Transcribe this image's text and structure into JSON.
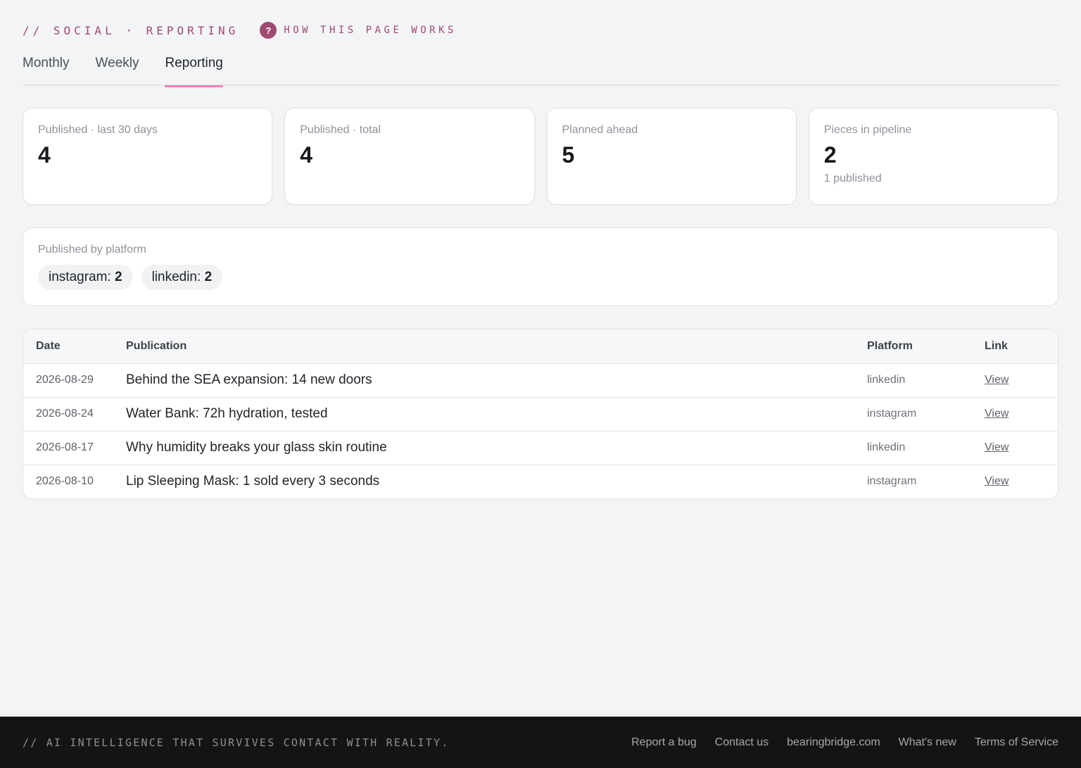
{
  "header": {
    "eyebrow": "// SOCIAL · REPORTING",
    "help_icon_glyph": "?",
    "help_label": "HOW THIS PAGE WORKS"
  },
  "tabs": [
    {
      "label": "Monthly",
      "active": false
    },
    {
      "label": "Weekly",
      "active": false
    },
    {
      "label": "Reporting",
      "active": true
    }
  ],
  "stats": [
    {
      "label": "Published · last 30 days",
      "value": "4",
      "sub": ""
    },
    {
      "label": "Published · total",
      "value": "4",
      "sub": ""
    },
    {
      "label": "Planned ahead",
      "value": "5",
      "sub": ""
    },
    {
      "label": "Pieces in pipeline",
      "value": "2",
      "sub": "1 published"
    }
  ],
  "by_platform": {
    "title": "Published by platform",
    "chips": [
      {
        "name": "instagram:",
        "count": "2"
      },
      {
        "name": "linkedin:",
        "count": "2"
      }
    ]
  },
  "table": {
    "headers": {
      "date": "Date",
      "publication": "Publication",
      "platform": "Platform",
      "link": "Link"
    },
    "rows": [
      {
        "date": "2026-08-29",
        "publication": "Behind the SEA expansion: 14 new doors",
        "platform": "linkedin",
        "link": "View"
      },
      {
        "date": "2026-08-24",
        "publication": "Water Bank: 72h hydration, tested",
        "platform": "instagram",
        "link": "View"
      },
      {
        "date": "2026-08-17",
        "publication": "Why humidity breaks your glass skin routine",
        "platform": "linkedin",
        "link": "View"
      },
      {
        "date": "2026-08-10",
        "publication": "Lip Sleeping Mask: 1 sold every 3 seconds",
        "platform": "instagram",
        "link": "View"
      }
    ]
  },
  "footer": {
    "tagline": "// AI INTELLIGENCE THAT SURVIVES CONTACT WITH REALITY.",
    "links": [
      "Report a bug",
      "Contact us",
      "bearingbridge.com",
      "What's new",
      "Terms of Service"
    ]
  },
  "colors": {
    "accent": "#9e4a72",
    "tab_underline": "#ec7fb6",
    "background": "#f3f4f6",
    "footer_bg": "#141414"
  }
}
